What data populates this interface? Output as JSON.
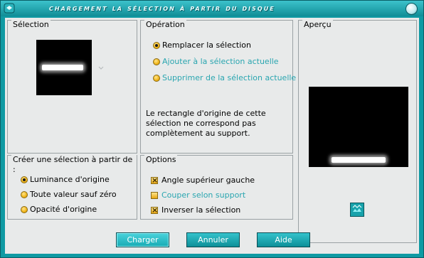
{
  "window": {
    "title": "Chargement la sélection à partir du disque"
  },
  "selection_group": {
    "title": "Sélection"
  },
  "operation_group": {
    "title": "Opération",
    "options": [
      {
        "label": "Remplacer la sélection",
        "selected": true,
        "enabled": true
      },
      {
        "label": "Ajouter à la sélection actuelle",
        "selected": false,
        "enabled": false
      },
      {
        "label": "Supprimer de la sélection actuelle",
        "selected": false,
        "enabled": false
      }
    ],
    "message": [
      "Le rectangle d'origine de cette",
      "sélection ne correspond pas",
      "complètement au support."
    ]
  },
  "preview_group": {
    "title": "Aperçu"
  },
  "create_group": {
    "title": "Créer une sélection à partir de :",
    "options": [
      {
        "label": "Luminance d'origine",
        "selected": true
      },
      {
        "label": "Toute valeur sauf zéro",
        "selected": false
      },
      {
        "label": "Opacité d'origine",
        "selected": false
      }
    ]
  },
  "options_group": {
    "title": "Options",
    "checks": [
      {
        "label": "Angle supérieur gauche",
        "checked": true,
        "enabled": true
      },
      {
        "label": "Couper selon support",
        "checked": false,
        "enabled": false
      },
      {
        "label": "Inverser la sélection",
        "checked": true,
        "enabled": true
      }
    ]
  },
  "buttons": {
    "load": "Charger",
    "cancel": "Annuler",
    "help": "Aide"
  },
  "colors": {
    "frame": "#0f9aa3",
    "disabled_text": "#2aa6b0",
    "radio": "#f0b418"
  }
}
